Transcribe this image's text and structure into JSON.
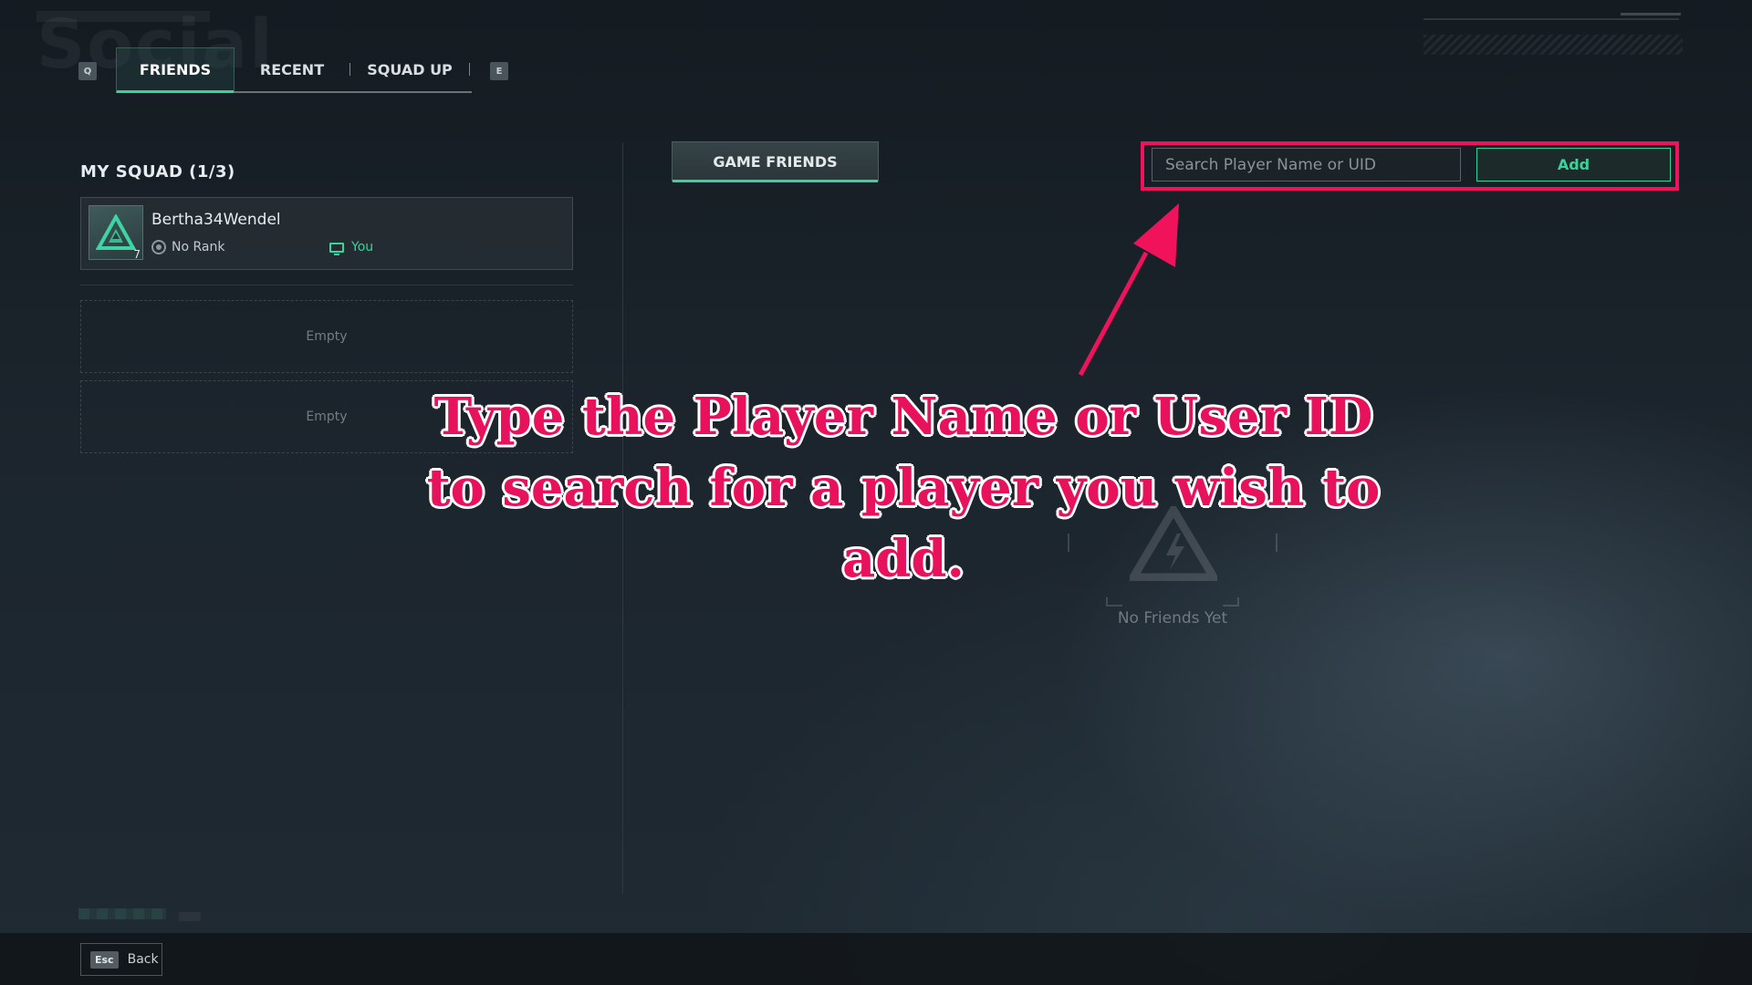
{
  "header": {
    "watermark": "Social"
  },
  "tabs": {
    "prev_key": "Q",
    "next_key": "E",
    "items": [
      {
        "label": "FRIENDS",
        "active": true
      },
      {
        "label": "RECENT",
        "active": false
      },
      {
        "label": "SQUAD UP",
        "active": false
      }
    ]
  },
  "squad": {
    "title": "MY SQUAD (1/3)",
    "member": {
      "name": "Bertha34Wendel",
      "level": "7",
      "rank": "No Rank",
      "tag": "You"
    },
    "empty_slots": [
      "Empty",
      "Empty"
    ]
  },
  "friends": {
    "subtab": "GAME FRIENDS",
    "search_placeholder": "Search Player Name or UID",
    "search_value": "",
    "add_label": "Add",
    "empty_text": "No Friends Yet"
  },
  "annotation": {
    "line1": "Type the Player Name or User ID",
    "line2": "to search for a player you wish to add."
  },
  "footer": {
    "back_key": "Esc",
    "back_label": "Back"
  },
  "colors": {
    "accent": "#35d49d",
    "highlight": "#f0135c",
    "background": "#1c252d"
  }
}
